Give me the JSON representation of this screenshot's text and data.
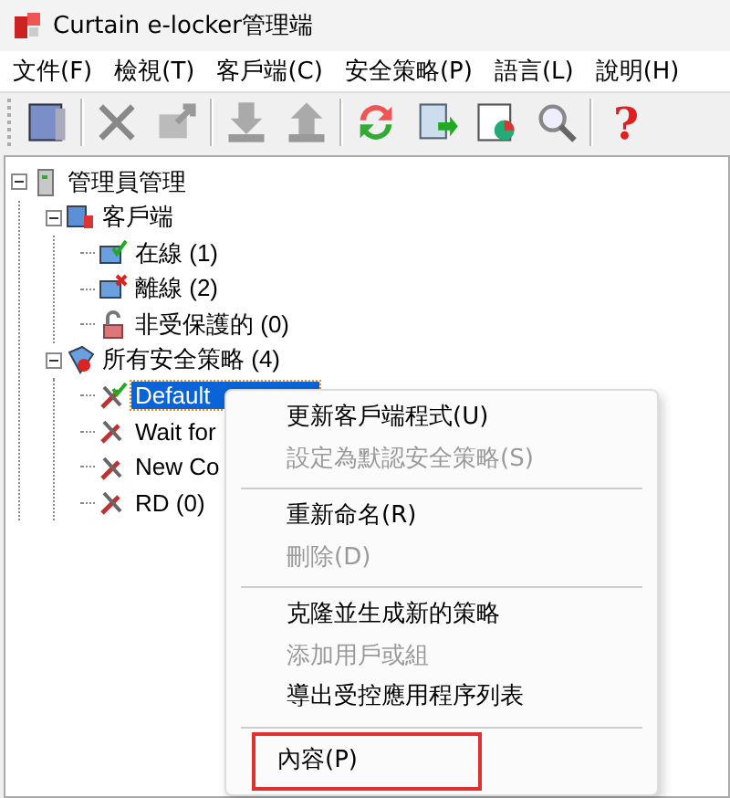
{
  "window": {
    "title": "Curtain e-locker管理端"
  },
  "menu": [
    "文件(F)",
    "檢視(T)",
    "客戶端(C)",
    "安全策略(P)",
    "語言(L)",
    "說明(H)"
  ],
  "toolbar_help": "?",
  "tree": [
    {
      "label": "管理員管理",
      "kind": "server",
      "expanded": true,
      "selected": false,
      "children": [
        {
          "label": "客戶端",
          "kind": "clients",
          "expanded": true,
          "selected": false,
          "children": [
            {
              "label": "在線 (1)",
              "kind": "online",
              "selected": false
            },
            {
              "label": "離線 (2)",
              "kind": "offline",
              "selected": false
            },
            {
              "label": "非受保護的 (0)",
              "kind": "unprotected",
              "selected": false
            }
          ]
        },
        {
          "label": "所有安全策略 (4)",
          "kind": "policies",
          "expanded": true,
          "selected": false,
          "children": [
            {
              "label": "Default",
              "kind": "policy-default",
              "selected": true
            },
            {
              "label": "Wait for",
              "kind": "policy",
              "selected": false
            },
            {
              "label": "New Co",
              "kind": "policy",
              "selected": false
            },
            {
              "label": "RD (0)",
              "kind": "policy",
              "selected": false
            }
          ]
        }
      ]
    }
  ],
  "context_menu": [
    {
      "kind": "item",
      "label": "更新客戶端程式(U)",
      "disabled": false,
      "highlighted": false
    },
    {
      "kind": "item",
      "label": "設定為默認安全策略(S)",
      "disabled": true,
      "highlighted": false
    },
    {
      "kind": "separator"
    },
    {
      "kind": "item",
      "label": "重新命名(R)",
      "disabled": false,
      "highlighted": false
    },
    {
      "kind": "item",
      "label": "刪除(D)",
      "disabled": true,
      "highlighted": false
    },
    {
      "kind": "separator"
    },
    {
      "kind": "item",
      "label": "克隆並生成新的策略",
      "disabled": false,
      "highlighted": false
    },
    {
      "kind": "item",
      "label": "添加用戶或組",
      "disabled": true,
      "highlighted": false
    },
    {
      "kind": "item",
      "label": "導出受控應用程序列表",
      "disabled": false,
      "highlighted": false
    },
    {
      "kind": "separator"
    },
    {
      "kind": "item",
      "label": "內容(P)",
      "disabled": false,
      "highlighted": true
    }
  ]
}
